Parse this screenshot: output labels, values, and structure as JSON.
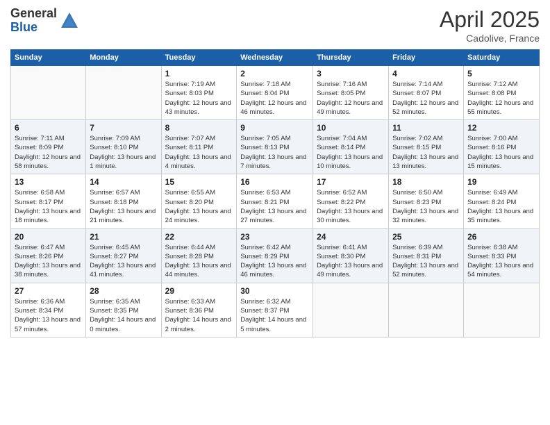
{
  "header": {
    "logo_general": "General",
    "logo_blue": "Blue",
    "month_year": "April 2025",
    "location": "Cadolive, France"
  },
  "weekdays": [
    "Sunday",
    "Monday",
    "Tuesday",
    "Wednesday",
    "Thursday",
    "Friday",
    "Saturday"
  ],
  "weeks": [
    [
      {
        "day": "",
        "info": ""
      },
      {
        "day": "",
        "info": ""
      },
      {
        "day": "1",
        "info": "Sunrise: 7:19 AM\nSunset: 8:03 PM\nDaylight: 12 hours and 43 minutes."
      },
      {
        "day": "2",
        "info": "Sunrise: 7:18 AM\nSunset: 8:04 PM\nDaylight: 12 hours and 46 minutes."
      },
      {
        "day": "3",
        "info": "Sunrise: 7:16 AM\nSunset: 8:05 PM\nDaylight: 12 hours and 49 minutes."
      },
      {
        "day": "4",
        "info": "Sunrise: 7:14 AM\nSunset: 8:07 PM\nDaylight: 12 hours and 52 minutes."
      },
      {
        "day": "5",
        "info": "Sunrise: 7:12 AM\nSunset: 8:08 PM\nDaylight: 12 hours and 55 minutes."
      }
    ],
    [
      {
        "day": "6",
        "info": "Sunrise: 7:11 AM\nSunset: 8:09 PM\nDaylight: 12 hours and 58 minutes."
      },
      {
        "day": "7",
        "info": "Sunrise: 7:09 AM\nSunset: 8:10 PM\nDaylight: 13 hours and 1 minute."
      },
      {
        "day": "8",
        "info": "Sunrise: 7:07 AM\nSunset: 8:11 PM\nDaylight: 13 hours and 4 minutes."
      },
      {
        "day": "9",
        "info": "Sunrise: 7:05 AM\nSunset: 8:13 PM\nDaylight: 13 hours and 7 minutes."
      },
      {
        "day": "10",
        "info": "Sunrise: 7:04 AM\nSunset: 8:14 PM\nDaylight: 13 hours and 10 minutes."
      },
      {
        "day": "11",
        "info": "Sunrise: 7:02 AM\nSunset: 8:15 PM\nDaylight: 13 hours and 13 minutes."
      },
      {
        "day": "12",
        "info": "Sunrise: 7:00 AM\nSunset: 8:16 PM\nDaylight: 13 hours and 15 minutes."
      }
    ],
    [
      {
        "day": "13",
        "info": "Sunrise: 6:58 AM\nSunset: 8:17 PM\nDaylight: 13 hours and 18 minutes."
      },
      {
        "day": "14",
        "info": "Sunrise: 6:57 AM\nSunset: 8:18 PM\nDaylight: 13 hours and 21 minutes."
      },
      {
        "day": "15",
        "info": "Sunrise: 6:55 AM\nSunset: 8:20 PM\nDaylight: 13 hours and 24 minutes."
      },
      {
        "day": "16",
        "info": "Sunrise: 6:53 AM\nSunset: 8:21 PM\nDaylight: 13 hours and 27 minutes."
      },
      {
        "day": "17",
        "info": "Sunrise: 6:52 AM\nSunset: 8:22 PM\nDaylight: 13 hours and 30 minutes."
      },
      {
        "day": "18",
        "info": "Sunrise: 6:50 AM\nSunset: 8:23 PM\nDaylight: 13 hours and 32 minutes."
      },
      {
        "day": "19",
        "info": "Sunrise: 6:49 AM\nSunset: 8:24 PM\nDaylight: 13 hours and 35 minutes."
      }
    ],
    [
      {
        "day": "20",
        "info": "Sunrise: 6:47 AM\nSunset: 8:26 PM\nDaylight: 13 hours and 38 minutes."
      },
      {
        "day": "21",
        "info": "Sunrise: 6:45 AM\nSunset: 8:27 PM\nDaylight: 13 hours and 41 minutes."
      },
      {
        "day": "22",
        "info": "Sunrise: 6:44 AM\nSunset: 8:28 PM\nDaylight: 13 hours and 44 minutes."
      },
      {
        "day": "23",
        "info": "Sunrise: 6:42 AM\nSunset: 8:29 PM\nDaylight: 13 hours and 46 minutes."
      },
      {
        "day": "24",
        "info": "Sunrise: 6:41 AM\nSunset: 8:30 PM\nDaylight: 13 hours and 49 minutes."
      },
      {
        "day": "25",
        "info": "Sunrise: 6:39 AM\nSunset: 8:31 PM\nDaylight: 13 hours and 52 minutes."
      },
      {
        "day": "26",
        "info": "Sunrise: 6:38 AM\nSunset: 8:33 PM\nDaylight: 13 hours and 54 minutes."
      }
    ],
    [
      {
        "day": "27",
        "info": "Sunrise: 6:36 AM\nSunset: 8:34 PM\nDaylight: 13 hours and 57 minutes."
      },
      {
        "day": "28",
        "info": "Sunrise: 6:35 AM\nSunset: 8:35 PM\nDaylight: 14 hours and 0 minutes."
      },
      {
        "day": "29",
        "info": "Sunrise: 6:33 AM\nSunset: 8:36 PM\nDaylight: 14 hours and 2 minutes."
      },
      {
        "day": "30",
        "info": "Sunrise: 6:32 AM\nSunset: 8:37 PM\nDaylight: 14 hours and 5 minutes."
      },
      {
        "day": "",
        "info": ""
      },
      {
        "day": "",
        "info": ""
      },
      {
        "day": "",
        "info": ""
      }
    ]
  ]
}
